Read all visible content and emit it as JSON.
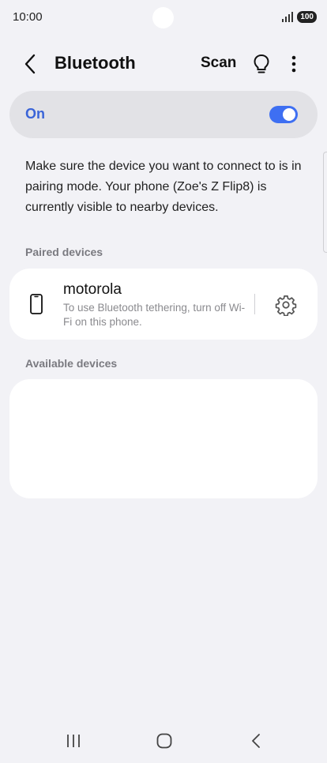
{
  "status_bar": {
    "time": "10:00",
    "battery": "100",
    "icons": [
      "signal-icon",
      "battery-icon"
    ]
  },
  "app_bar": {
    "title": "Bluetooth",
    "scan_label": "Scan",
    "icons": [
      "back-arrow-icon",
      "lightbulb-icon",
      "more-vert-icon"
    ]
  },
  "master_switch": {
    "label": "On",
    "checked": true,
    "accent_color": "#3e6ff2",
    "label_color": "#3a64d8"
  },
  "info_text": "Make sure the device you want to connect to is in pairing mode. Your phone (Zoe's Z Flip8) is currently visible to nearby devices.",
  "paired_section": {
    "label": "Paired devices",
    "devices": [
      {
        "name": "motorola",
        "subtitle": "To use Bluetooth tethering, turn off Wi-Fi on this phone.",
        "icon": "phone-icon",
        "action_icon": "gear-icon"
      }
    ]
  },
  "available_section": {
    "label": "Available devices",
    "devices": []
  },
  "nav_bar": {
    "icons": [
      "recents-icon",
      "home-icon",
      "back-icon"
    ]
  }
}
